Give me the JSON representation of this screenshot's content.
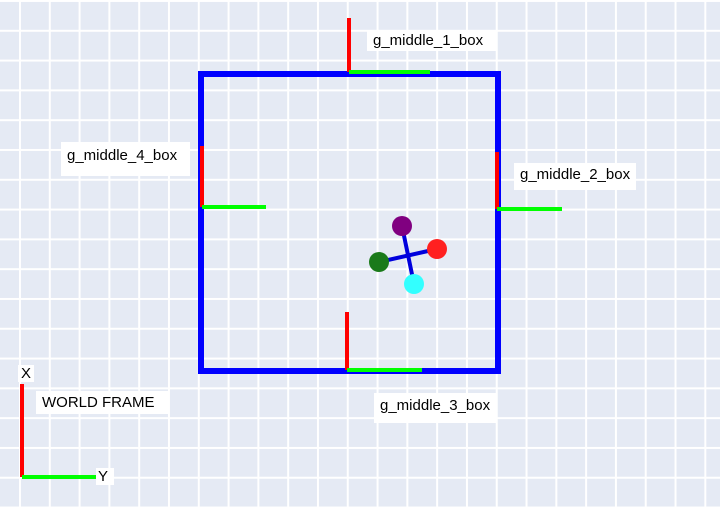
{
  "frames": [
    {
      "label": "g_middle_1_box"
    },
    {
      "label": "g_middle_2_box"
    },
    {
      "label": "g_middle_3_box"
    },
    {
      "label": "g_middle_4_box"
    }
  ],
  "world_frame": {
    "label": "WORLD FRAME",
    "x_axis_label": "X",
    "y_axis_label": "Y"
  },
  "colors": {
    "background": "#e5eaf4",
    "grid": "#ffffff",
    "box_outline": "#0000ff",
    "x_axis": "#ff0000",
    "y_axis": "#00ff00",
    "marker_purple": "#800080",
    "marker_red": "#ff2020",
    "marker_green": "#1a7a1a",
    "marker_cyan": "#33ffff",
    "marker_link": "#0000dd"
  }
}
